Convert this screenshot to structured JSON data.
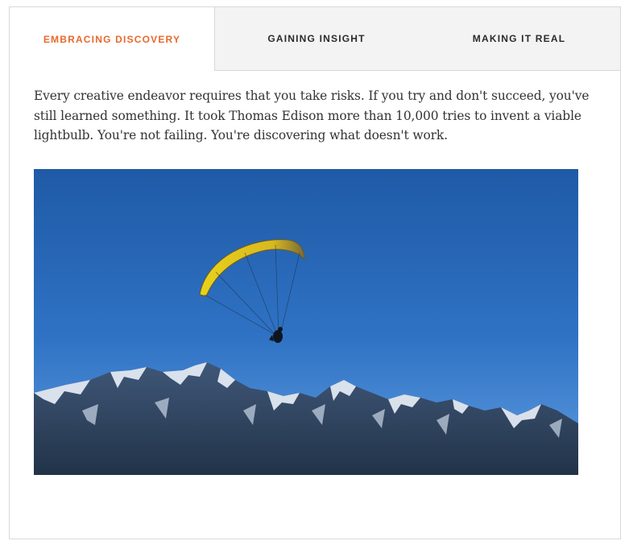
{
  "tabs": [
    {
      "label": "EMBRACING DISCOVERY",
      "active": true
    },
    {
      "label": "GAINING INSIGHT",
      "active": false
    },
    {
      "label": "MAKING IT REAL",
      "active": false
    }
  ],
  "panel": {
    "paragraph": "Every creative endeavor requires that you take risks. If you try and don't succeed, you've still learned something. It took Thomas Edison more than 10,000 tries to invent a viable lightbulb. You're not failing. You're discovering what doesn't work."
  },
  "colors": {
    "accent": "#e8692b",
    "sky": "#2f6fbf",
    "tab_inactive_bg": "#f3f3f3"
  }
}
